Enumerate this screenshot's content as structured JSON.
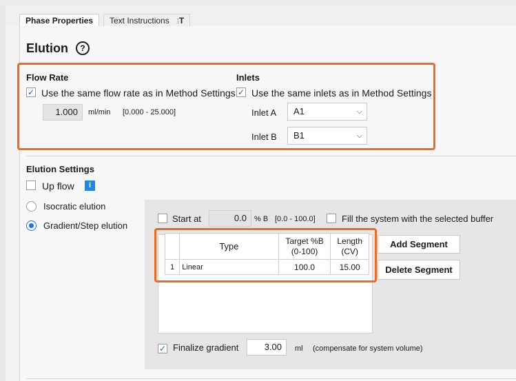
{
  "tabs": [
    "Phase Properties",
    "Text Instructions",
    "T"
  ],
  "header": {
    "title": "Elution",
    "help_glyph": "?"
  },
  "flow_rate": {
    "title": "Flow Rate",
    "checkbox_label": "Use the same flow rate as in Method Settings",
    "checked": true,
    "value": "1.000",
    "unit": "ml/min",
    "range": "[0.000 - 25.000]"
  },
  "inlets": {
    "title": "Inlets",
    "checkbox_label": "Use the same inlets as in Method Settings",
    "checked": true,
    "inlet_a": {
      "label": "Inlet A",
      "value": "A1"
    },
    "inlet_b": {
      "label": "Inlet B",
      "value": "B1"
    }
  },
  "elution_settings": {
    "title": "Elution Settings",
    "up_flow": {
      "label": "Up flow",
      "checked": false
    },
    "isocratic_label": "Isocratic elution",
    "gradient_label": "Gradient/Step elution",
    "selected": "gradient"
  },
  "start_at": {
    "label": "Start at",
    "value": "0.0",
    "unit": "% B",
    "range": "[0.0 - 100.0]",
    "checked": false
  },
  "fill_system": {
    "label": "Fill the system with the selected buffer",
    "checked": false
  },
  "segment_table": {
    "headers": [
      "Type",
      "Target %B\n(0-100)",
      "Length\n(CV)"
    ],
    "rows": [
      {
        "num": "1",
        "type": "Linear",
        "target": "100.0",
        "length": "15.00"
      }
    ]
  },
  "buttons": {
    "add_segment": "Add Segment",
    "delete_segment": "Delete Segment"
  },
  "finalize": {
    "label": "Finalize gradient",
    "checked": true,
    "value": "3.00",
    "unit": "ml",
    "note": "(compensate for system volume)"
  },
  "colors": {
    "highlight": "#ee6a20",
    "accent": "#2b6fd6",
    "info": "#1e88e5"
  },
  "icons": {
    "help": "help-circle-icon",
    "info": "info-icon",
    "check": "checkmark-icon",
    "dropdown": "chevron-down-icon"
  }
}
